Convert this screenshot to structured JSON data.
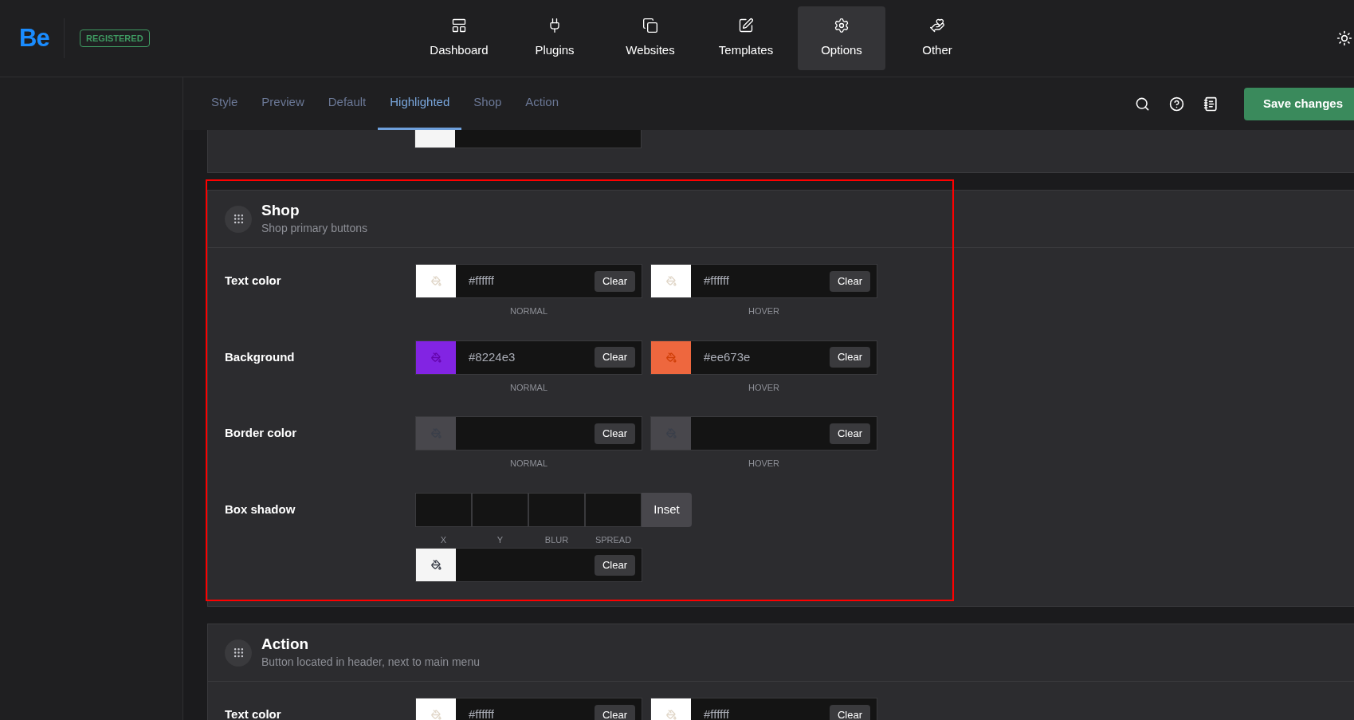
{
  "header": {
    "logo": "Be",
    "badge": "REGISTERED",
    "nav": [
      {
        "label": "Dashboard",
        "selected": false
      },
      {
        "label": "Plugins",
        "selected": false
      },
      {
        "label": "Websites",
        "selected": false
      },
      {
        "label": "Templates",
        "selected": false
      },
      {
        "label": "Options",
        "selected": true
      },
      {
        "label": "Other",
        "selected": false
      }
    ]
  },
  "toolbar": {
    "tabs": [
      {
        "label": "Style",
        "selected": false
      },
      {
        "label": "Preview",
        "selected": false
      },
      {
        "label": "Default",
        "selected": false
      },
      {
        "label": "Highlighted",
        "selected": true
      },
      {
        "label": "Shop",
        "selected": false
      },
      {
        "label": "Action",
        "selected": false
      }
    ],
    "save_button": "Save changes"
  },
  "partial_section": {
    "field": {
      "color": "#f5f5f5"
    }
  },
  "sections": [
    {
      "title": "Shop",
      "subtitle": "Shop primary buttons",
      "highlighted": true,
      "rows": [
        {
          "kind": "color",
          "label": "Text color",
          "fields": [
            {
              "color": "#ffffff",
              "value": "#ffffff",
              "button": "Clear",
              "caption": "NORMAL"
            },
            {
              "color": "#ffffff",
              "value": "#ffffff",
              "button": "Clear",
              "caption": "HOVER"
            }
          ]
        },
        {
          "kind": "color",
          "label": "Background",
          "fields": [
            {
              "color": "#8224e3",
              "value": "#8224e3",
              "button": "Clear",
              "caption": "NORMAL"
            },
            {
              "color": "#ee673e",
              "value": "#ee673e",
              "button": "Clear",
              "caption": "HOVER"
            }
          ]
        },
        {
          "kind": "color",
          "label": "Border color",
          "fields": [
            {
              "color": "#48474c",
              "button": "Clear",
              "caption": "NORMAL"
            },
            {
              "color": "#48474c",
              "button": "Clear",
              "caption": "HOVER"
            }
          ]
        },
        {
          "kind": "shadow",
          "label": "Box shadow",
          "inputs": [
            "X",
            "Y",
            "BLUR",
            "SPREAD"
          ],
          "inset": "Inset",
          "field": {
            "color": "#f5f5f5",
            "button": "Clear"
          }
        }
      ]
    },
    {
      "title": "Action",
      "subtitle": "Button located in header, next to main menu",
      "highlighted": false,
      "rows": [
        {
          "kind": "color",
          "label": "Text color",
          "fields": [
            {
              "color": "#ffffff",
              "value": "#ffffff",
              "button": "Clear"
            },
            {
              "color": "#ffffff",
              "value": "#ffffff",
              "button": "Clear"
            }
          ]
        }
      ]
    }
  ]
}
